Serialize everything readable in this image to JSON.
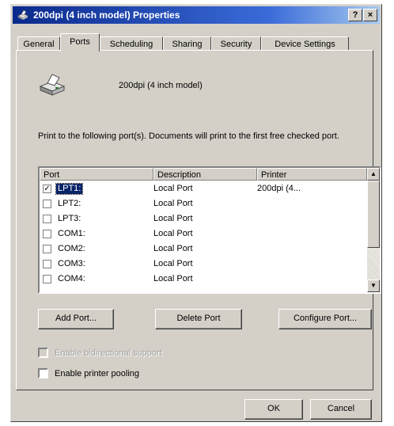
{
  "window": {
    "title": "200dpi (4 inch model) Properties",
    "help_button": "?",
    "close_button": "×",
    "app_icon": "printer-icon"
  },
  "tabs": [
    {
      "label": "General"
    },
    {
      "label": "Ports"
    },
    {
      "label": "Scheduling"
    },
    {
      "label": "Sharing"
    },
    {
      "label": "Security"
    },
    {
      "label": "Device Settings"
    }
  ],
  "active_tab": "Ports",
  "printer": {
    "name": "200dpi (4 inch model)",
    "icon": "printer-icon"
  },
  "ports_description": "Print to the following port(s). Documents will print to the first free checked port.",
  "ports_table": {
    "columns": [
      "Port",
      "Description",
      "Printer"
    ],
    "rows": [
      {
        "port": "LPT1:",
        "description": "Local Port",
        "printer": "200dpi (4...",
        "checked": true,
        "selected": true
      },
      {
        "port": "LPT2:",
        "description": "Local Port",
        "printer": "",
        "checked": false,
        "selected": false
      },
      {
        "port": "LPT3:",
        "description": "Local Port",
        "printer": "",
        "checked": false,
        "selected": false
      },
      {
        "port": "COM1:",
        "description": "Local Port",
        "printer": "",
        "checked": false,
        "selected": false
      },
      {
        "port": "COM2:",
        "description": "Local Port",
        "printer": "",
        "checked": false,
        "selected": false
      },
      {
        "port": "COM3:",
        "description": "Local Port",
        "printer": "",
        "checked": false,
        "selected": false
      },
      {
        "port": "COM4:",
        "description": "Local Port",
        "printer": "",
        "checked": false,
        "selected": false
      }
    ]
  },
  "port_buttons": {
    "add": "Add Port...",
    "delete": "Delete Port",
    "configure": "Configure Port..."
  },
  "options": {
    "bidirectional": {
      "label": "Enable bidirectional support",
      "checked": false,
      "enabled": false
    },
    "pooling": {
      "label": "Enable printer pooling",
      "checked": false,
      "enabled": true
    }
  },
  "dialog_buttons": {
    "ok": "OK",
    "cancel": "Cancel"
  }
}
